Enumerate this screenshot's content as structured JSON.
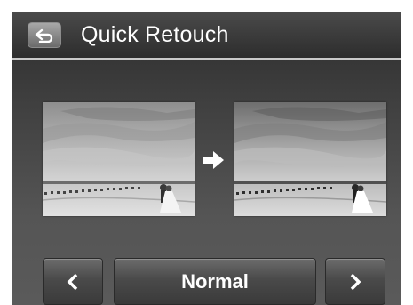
{
  "header": {
    "title": "Quick Retouch",
    "back_icon": "return-arrow-icon"
  },
  "preview": {
    "before_image": "beach-wedding-photo",
    "after_image": "beach-wedding-photo-retouched",
    "arrow_icon": "arrow-right-icon"
  },
  "selector": {
    "prev_icon": "chevron-left-icon",
    "current_mode": "Normal",
    "next_icon": "chevron-right-icon"
  },
  "colors": {
    "title_text": "#ffffff",
    "divider": "#c9c9c9"
  }
}
